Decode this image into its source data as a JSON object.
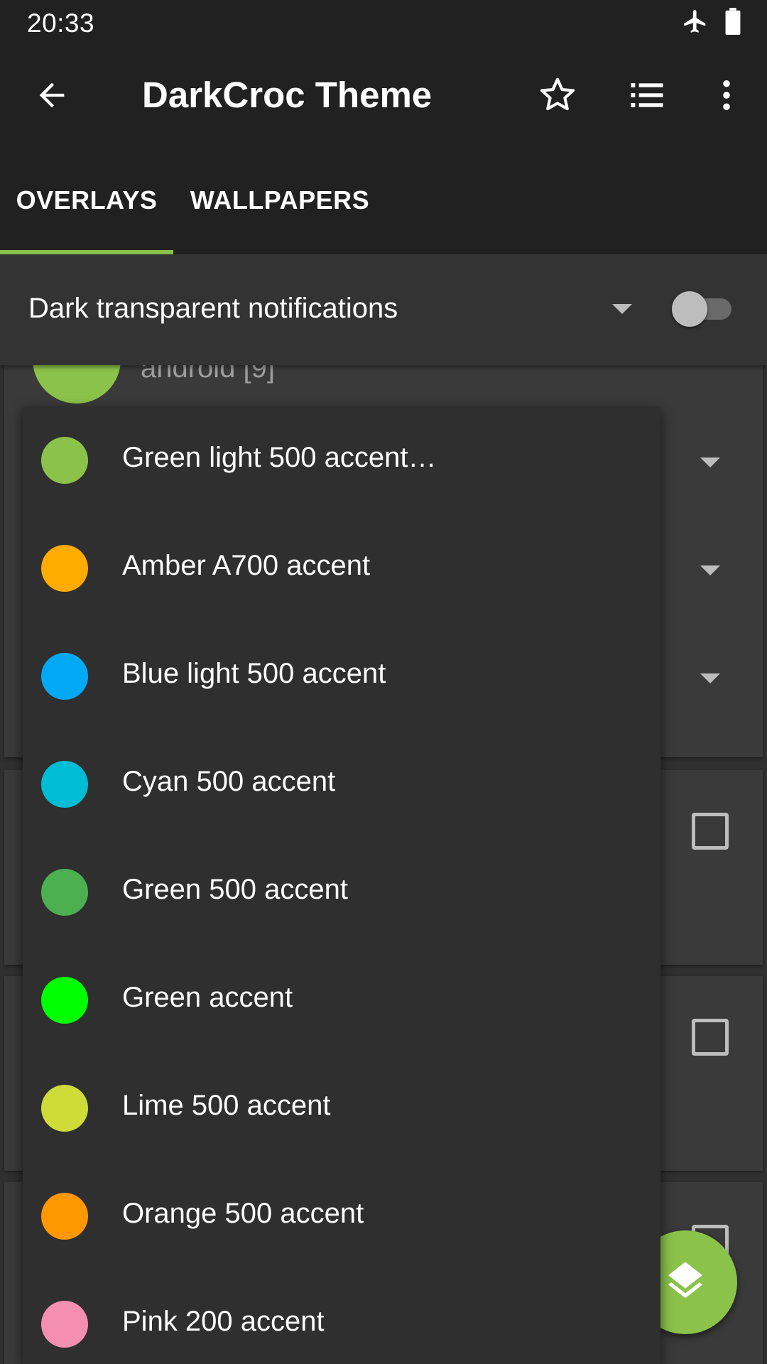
{
  "status_bar": {
    "time": "20:33",
    "icons": [
      "airplane-mode-icon",
      "battery-icon"
    ]
  },
  "app_bar": {
    "title": "DarkCroc Theme",
    "icons": [
      "back-arrow-icon",
      "star-outline-icon",
      "list-icon",
      "more-vert-icon"
    ]
  },
  "tabs": [
    {
      "label": "OVERLAYS",
      "selected": true
    },
    {
      "label": "WALLPAPERS",
      "selected": false
    }
  ],
  "header_row": {
    "label": "Dark transparent notifications",
    "toggle_on": false
  },
  "background_list": {
    "package_label": "android [9]"
  },
  "dropdown_options": [
    {
      "label": "Green light 500 accent…",
      "color": "#8bc34a"
    },
    {
      "label": "Amber A700 accent",
      "color": "#ffab00"
    },
    {
      "label": "Blue light 500 accent",
      "color": "#03a9f4"
    },
    {
      "label": "Cyan 500 accent",
      "color": "#00bcd4"
    },
    {
      "label": "Green 500 accent",
      "color": "#4caf50"
    },
    {
      "label": "Green accent",
      "color": "#00ff00"
    },
    {
      "label": "Lime 500 accent",
      "color": "#cddc39"
    },
    {
      "label": "Orange 500 accent",
      "color": "#ff9800"
    },
    {
      "label": "Pink 200 accent",
      "color": "#f48fb1"
    }
  ],
  "colors": {
    "accent": "#8bc34a",
    "app_bar": "#212121",
    "popup": "#2f2f2f"
  },
  "fab": {
    "icon": "layers-icon"
  }
}
